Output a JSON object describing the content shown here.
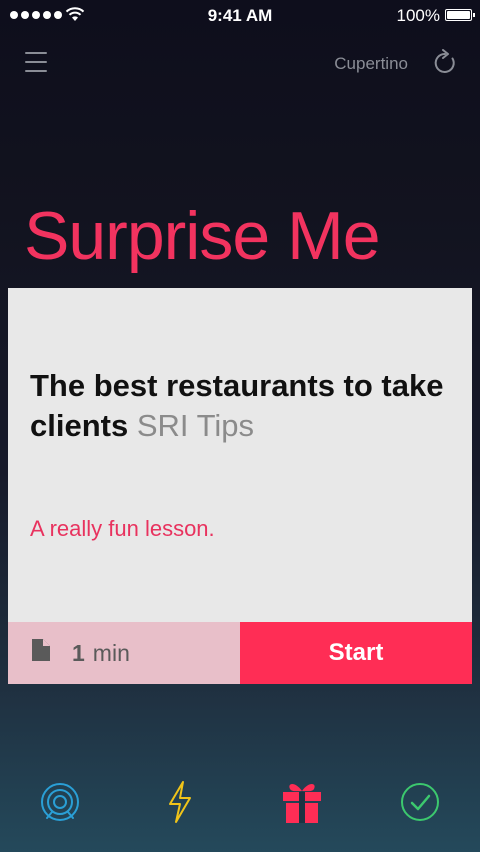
{
  "status_bar": {
    "time": "9:41 AM",
    "battery": "100%"
  },
  "header": {
    "location": "Cupertino",
    "menu_icon": "hamburger-menu-icon",
    "refresh_icon": "refresh-icon"
  },
  "headline": "Surprise Me",
  "card": {
    "title": "The best restaurants to take clients",
    "source": "SRI Tips",
    "description": "A really fun lesson.",
    "duration_value": "1",
    "duration_unit": "min",
    "start_label": "Start"
  },
  "tabs": [
    {
      "icon": "target-icon",
      "color": "#2a9fd6"
    },
    {
      "icon": "lightning-icon",
      "color": "#f0c419"
    },
    {
      "icon": "gift-icon",
      "color": "#ff2d55",
      "active": true
    },
    {
      "icon": "check-circle-icon",
      "color": "#3cc86e"
    }
  ],
  "colors": {
    "accent": "#ff2d55",
    "headline": "#f2335f",
    "card_bg": "#e8e8e8",
    "duration_bg": "#e8bfc9"
  }
}
